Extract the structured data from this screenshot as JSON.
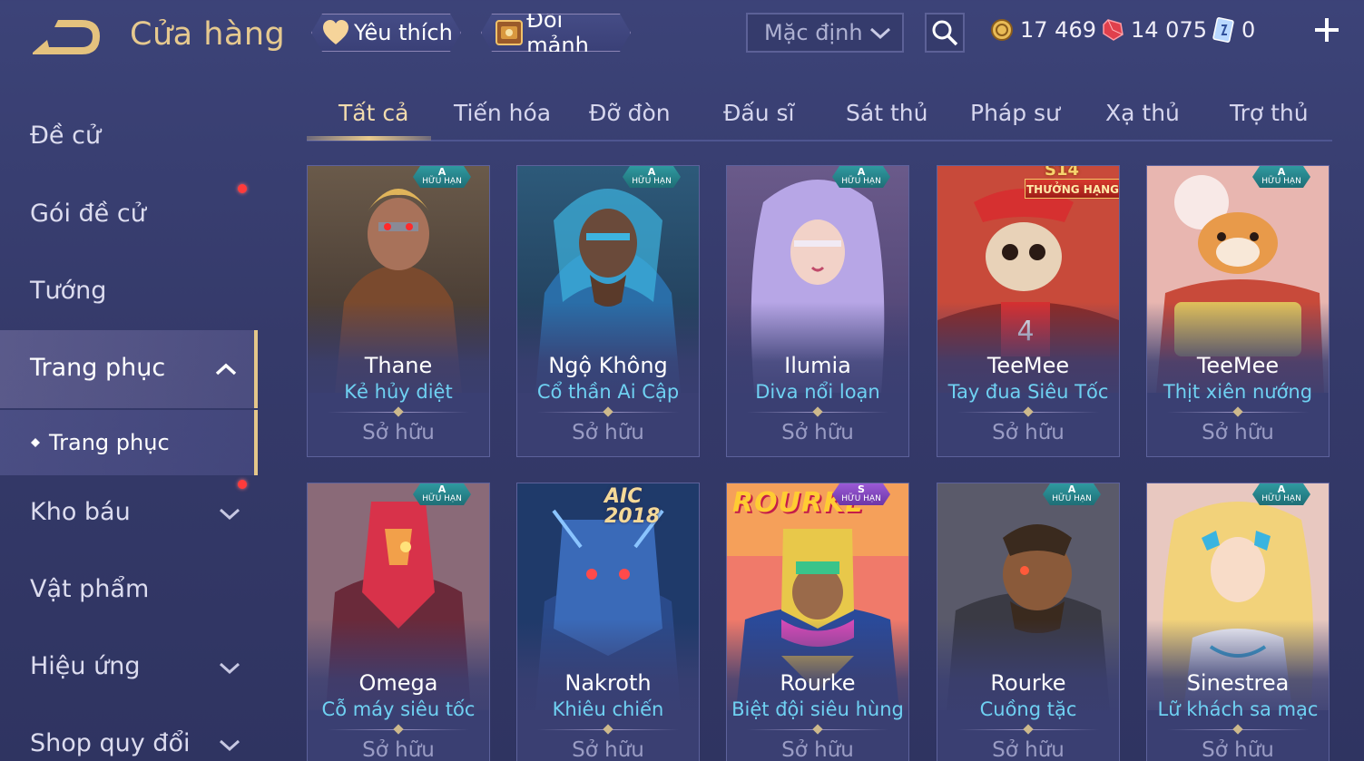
{
  "header": {
    "back_icon": "back-arrow-icon",
    "title": "Cửa hàng",
    "favorite_label": "Yêu thích",
    "shard_label": "Đổi mảnh",
    "sort": {
      "selected": "Mặc định"
    },
    "currencies": {
      "gold": "17 469",
      "ruby": "14 075",
      "voucher": "0"
    },
    "colors": {
      "title": "#e6c98f",
      "accent_gold": "#e5c78a",
      "skin_name": "#6fd1f2",
      "notification": "#ff3b3b"
    }
  },
  "sidebar": {
    "items": [
      {
        "label": "Đề cử"
      },
      {
        "label": "Gói đề cử"
      },
      {
        "label": "Tướng"
      },
      {
        "label": "Trang phục"
      },
      {
        "label": "Trang phục"
      },
      {
        "label": "Kho báu"
      },
      {
        "label": "Vật phẩm"
      },
      {
        "label": "Hiệu ứng"
      },
      {
        "label": "Shop quy đổi"
      }
    ]
  },
  "tabs": [
    {
      "label": "Tất cả"
    },
    {
      "label": "Tiến hóa"
    },
    {
      "label": "Đỡ đòn"
    },
    {
      "label": "Đấu sĩ"
    },
    {
      "label": "Sát thủ"
    },
    {
      "label": "Pháp sư"
    },
    {
      "label": "Xạ thủ"
    },
    {
      "label": "Trợ thủ"
    }
  ],
  "badges": {
    "grade_a": "A",
    "grade_s": "S",
    "limited": "HỮU HẠN",
    "season": "S14",
    "ranked": "THƯỞNG HẠNG",
    "aic": "AIC",
    "aic_year": "2018",
    "banner": "ROURKE SUPER TEAM"
  },
  "skins": [
    {
      "hero": "Thane",
      "skin": "Kẻ hủy diệt",
      "status": "Sở hữu"
    },
    {
      "hero": "Ngộ Không",
      "skin": "Cổ thần Ai Cập",
      "status": "Sở hữu"
    },
    {
      "hero": "Ilumia",
      "skin": "Diva nổi loạn",
      "status": "Sở hữu"
    },
    {
      "hero": "TeeMee",
      "skin": "Tay đua Siêu Tốc",
      "status": "Sở hữu"
    },
    {
      "hero": "TeeMee",
      "skin": "Thịt xiên nướng",
      "status": "Sở hữu"
    },
    {
      "hero": "Omega",
      "skin": "Cỗ máy siêu tốc",
      "status": "Sở hữu"
    },
    {
      "hero": "Nakroth",
      "skin": "Khiêu chiến",
      "status": "Sở hữu"
    },
    {
      "hero": "Rourke",
      "skin": "Biệt đội siêu hùng",
      "status": "Sở hữu"
    },
    {
      "hero": "Rourke",
      "skin": "Cuồng tặc",
      "status": "Sở hữu"
    },
    {
      "hero": "Sinestrea",
      "skin": "Lữ khách sa mạc",
      "status": "Sở hữu"
    }
  ]
}
